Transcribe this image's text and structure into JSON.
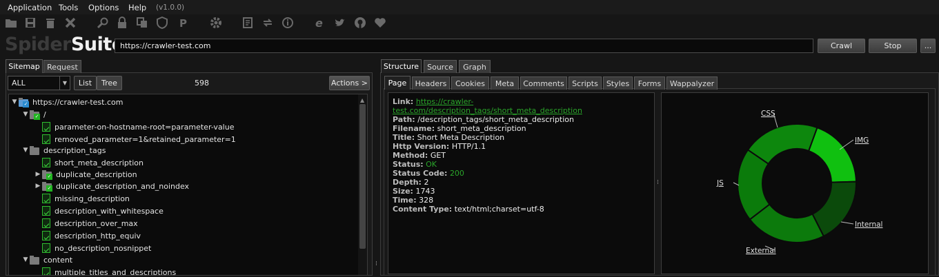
{
  "menu": {
    "items": [
      "Application",
      "Tools",
      "Options",
      "Help"
    ],
    "version": "(v1.0.0)"
  },
  "toolbar_icons": [
    "open-folder-icon",
    "save-icon",
    "delete-icon",
    "close-icon",
    "search-icon",
    "lock-icon",
    "copy-icon",
    "shield-icon",
    "parking-icon",
    "gear-icon",
    "notes-icon",
    "refresh-icon",
    "info-icon",
    "internet-explorer-icon",
    "twitter-icon",
    "github-icon",
    "heart-icon"
  ],
  "logo": {
    "part1": "Spider",
    "part2": "Suite"
  },
  "crawl": {
    "url": "https://crawler-test.com",
    "crawl_label": "Crawl",
    "stop_label": "Stop",
    "more_label": "..."
  },
  "left_tabs": {
    "sitemap": "Sitemap",
    "request": "Request"
  },
  "filter": {
    "value": "ALL",
    "list_label": "List",
    "tree_label": "Tree",
    "count": "598",
    "actions_label": "Actions >"
  },
  "tree": [
    {
      "label": "https://crawler-test.com",
      "type": "root",
      "expanded": true
    },
    {
      "label": "/",
      "type": "folder-check",
      "expanded": true
    },
    {
      "label": "parameter-on-hostname-root=parameter-value",
      "type": "page"
    },
    {
      "label": "removed_parameter=1&retained_parameter=1",
      "type": "page"
    },
    {
      "label": "description_tags",
      "type": "folder",
      "expanded": true
    },
    {
      "label": "short_meta_description",
      "type": "page"
    },
    {
      "label": "duplicate_description",
      "type": "folder-check",
      "expanded": false
    },
    {
      "label": "duplicate_description_and_noindex",
      "type": "folder-check",
      "expanded": false
    },
    {
      "label": "missing_description",
      "type": "page"
    },
    {
      "label": "description_with_whitespace",
      "type": "page"
    },
    {
      "label": "description_over_max",
      "type": "page"
    },
    {
      "label": "description_http_equiv",
      "type": "page"
    },
    {
      "label": "no_description_nosnippet",
      "type": "page"
    },
    {
      "label": "content",
      "type": "folder",
      "expanded": true
    },
    {
      "label": "multiple_titles_and_descriptions",
      "type": "page"
    }
  ],
  "right_tabs": [
    "Structure",
    "Source",
    "Graph"
  ],
  "sub_tabs": [
    "Page",
    "Headers",
    "Cookies",
    "Meta",
    "Comments",
    "Scripts",
    "Styles",
    "Forms",
    "Wappalyzer"
  ],
  "page_info": [
    {
      "key": "Link:",
      "value": "https://crawler-test.com/description_tags/short_meta_description",
      "style": "link"
    },
    {
      "key": "Path:",
      "value": "/description_tags/short_meta_description"
    },
    {
      "key": "Filename:",
      "value": "short_meta_description"
    },
    {
      "key": "Title:",
      "value": "Short Meta Description"
    },
    {
      "key": "Http Version:",
      "value": "HTTP/1.1"
    },
    {
      "key": "Method:",
      "value": "GET"
    },
    {
      "key": "Status:",
      "value": "OK",
      "style": "green"
    },
    {
      "key": "Status Code:",
      "value": "200",
      "style": "green"
    },
    {
      "key": "Depth:",
      "value": "2"
    },
    {
      "key": "Size:",
      "value": "1743"
    },
    {
      "key": "Time:",
      "value": "328"
    },
    {
      "key": "Content Type:",
      "value": "text/html;charset=utf-8"
    }
  ],
  "chart_data": {
    "type": "pie",
    "categories": [
      "IMG",
      "Internal",
      "External",
      "JS",
      "CSS"
    ],
    "values": [
      0.19,
      0.18,
      0.22,
      0.2,
      0.21
    ],
    "colors": [
      "#10c010",
      "#0b4a0b",
      "#0c7a0c",
      "#0b7b0b",
      "#0d870d"
    ]
  }
}
